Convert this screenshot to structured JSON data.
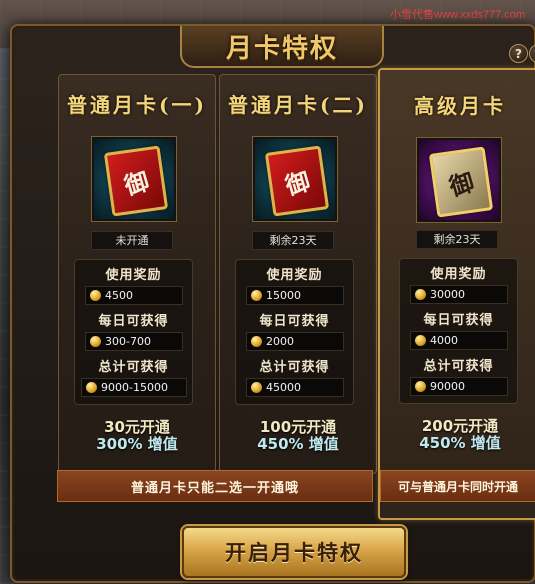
{
  "window": {
    "title": "月卡特权",
    "watermark": "小雪代售www.xxds777.com",
    "help_label": "?",
    "close_label": "×"
  },
  "cards": [
    {
      "title": "普通月卡(一)",
      "glyph": "御",
      "status": "未开通",
      "labels": [
        "使用奖励",
        "每日可获得",
        "总计可获得"
      ],
      "use_reward": "4500",
      "daily": "300-700",
      "total": "9000-15000",
      "price": "30元开通",
      "bonus": "300% 增值"
    },
    {
      "title": "普通月卡(二)",
      "glyph": "御",
      "status": "剩余23天",
      "labels": [
        "使用奖励",
        "每日可获得",
        "总计可获得"
      ],
      "use_reward": "15000",
      "daily": "2000",
      "total": "45000",
      "price": "100元开通",
      "bonus": "450% 增值"
    },
    {
      "title": "高级月卡",
      "glyph": "御",
      "status": "剩余23天",
      "labels": [
        "使用奖励",
        "每日可获得",
        "总计可获得"
      ],
      "use_reward": "30000",
      "daily": "4000",
      "total": "90000",
      "price": "200元开通",
      "bonus": "450% 增值"
    }
  ],
  "notes": {
    "normal": "普通月卡只能二选一开通哦",
    "premium": "可与普通月卡同时开通"
  },
  "open_button": "开启月卡特权",
  "colors": {
    "gold": "#f2d57c",
    "bar": "#7a3a18",
    "premium_border": "#c89a48"
  }
}
